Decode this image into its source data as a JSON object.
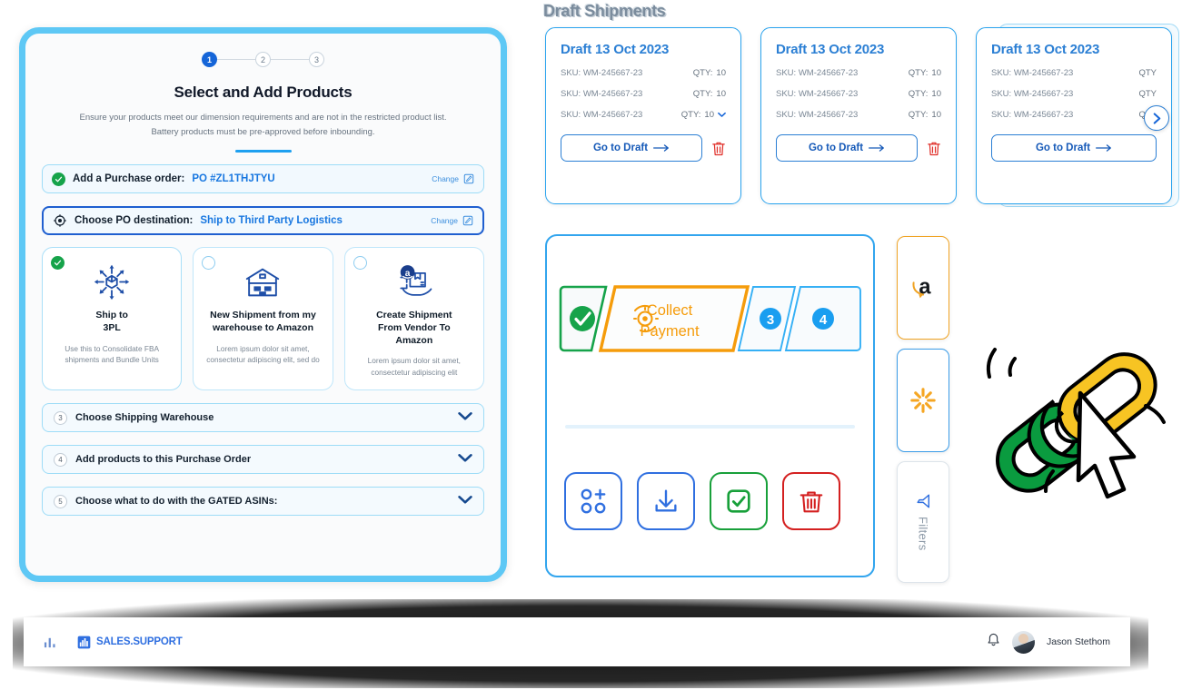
{
  "wizard": {
    "steps": [
      {
        "label": "1",
        "state": "active"
      },
      {
        "label": "2",
        "state": "idle"
      },
      {
        "label": "3",
        "state": "idle"
      }
    ],
    "title": "Select and Add Products",
    "subtitle_line1": "Ensure your products meet our dimension requirements and are not in the restricted product list.",
    "subtitle_line2": "Battery products must be pre-approved before inbounding.",
    "purchase_order": {
      "label": "Add a Purchase order:",
      "value": "PO #ZL1THJTYU",
      "change_label": "Change"
    },
    "destination": {
      "label": "Choose PO destination:",
      "value": "Ship to Third Party Logistics",
      "change_label": "Change"
    },
    "destination_options": [
      {
        "title": "Ship to\n3PL",
        "title_line1": "Ship to",
        "title_line2": "3PL",
        "desc": "Use this to Consolidate FBA shipments and Bundle Units",
        "selected": true,
        "icon": "distribution-network-icon"
      },
      {
        "title_line1": "New Shipment from my",
        "title_line2": "warehouse to Amazon",
        "desc": "Lorem ipsum dolor sit amet, consectetur adipiscing elit, sed do",
        "selected": false,
        "icon": "warehouse-icon"
      },
      {
        "title_line1": "Create Shipment",
        "title_line2": "From Vendor To",
        "title_line3": "Amazon",
        "desc": "Lorem ipsum dolor sit amet, consectetur adipiscing elit",
        "selected": false,
        "icon": "amazon-parcel-handoff-icon"
      }
    ],
    "accordions": [
      {
        "num": "3",
        "label": "Choose Shipping Warehouse"
      },
      {
        "num": "4",
        "label": "Add products to this Purchase Order"
      },
      {
        "num": "5",
        "label": "Choose what to do with the GATED ASINs:"
      }
    ]
  },
  "drafts": {
    "section_title": "Draft Shipments",
    "next_arrow_label": "›",
    "cards": [
      {
        "title": "Draft 13 Oct 2023",
        "rows": [
          {
            "sku_label": "SKU:",
            "sku": "WM-245667-23",
            "qty_label": "QTY:",
            "qty": "10",
            "has_dropdown": false
          },
          {
            "sku_label": "SKU:",
            "sku": "WM-245667-23",
            "qty_label": "QTY:",
            "qty": "10",
            "has_dropdown": false
          },
          {
            "sku_label": "SKU:",
            "sku": "WM-245667-23",
            "qty_label": "QTY:",
            "qty": "10",
            "has_dropdown": true
          }
        ],
        "button": "Go to Draft"
      },
      {
        "title": "Draft 13 Oct 2023",
        "rows": [
          {
            "sku_label": "SKU:",
            "sku": "WM-245667-23",
            "qty_label": "QTY:",
            "qty": "10",
            "has_dropdown": false
          },
          {
            "sku_label": "SKU:",
            "sku": "WM-245667-23",
            "qty_label": "QTY:",
            "qty": "10",
            "has_dropdown": false
          },
          {
            "sku_label": "SKU:",
            "sku": "WM-245667-23",
            "qty_label": "QTY:",
            "qty": "10",
            "has_dropdown": false
          }
        ],
        "button": "Go to Draft"
      },
      {
        "title": "Draft 13 Oct 2023",
        "rows": [
          {
            "sku_label": "SKU:",
            "sku": "WM-245667-23",
            "qty_label": "QTY",
            "qty": "",
            "has_dropdown": false
          },
          {
            "sku_label": "SKU:",
            "sku": "WM-245667-23",
            "qty_label": "QTY",
            "qty": "",
            "has_dropdown": false
          },
          {
            "sku_label": "SKU:",
            "sku": "WM-245667-23",
            "qty_label": "QTY",
            "qty": "",
            "has_dropdown": false
          }
        ],
        "button": "Go to Draft"
      }
    ]
  },
  "payment_panel": {
    "flow_steps": [
      {
        "id": "done",
        "label": "",
        "state": "complete",
        "color": "#16a34a"
      },
      {
        "id": "collect",
        "label_line1": "Collect",
        "label_line2": "Payment",
        "state": "current",
        "color": "#f59c0b"
      },
      {
        "id": "3",
        "label": "3",
        "state": "upcoming",
        "color": "#1a9ef0"
      },
      {
        "id": "4",
        "label": "4",
        "state": "upcoming",
        "color": "#1a9ef0"
      }
    ],
    "actions": [
      {
        "name": "add-items-button",
        "icon": "grid-plus-icon",
        "color": "#2f6fe0"
      },
      {
        "name": "download-button",
        "icon": "download-icon",
        "color": "#2f6fe0"
      },
      {
        "name": "approve-button",
        "icon": "checkbox-check-icon",
        "color": "#18a03a"
      },
      {
        "name": "delete-button",
        "icon": "trash-icon",
        "color": "#d42020"
      }
    ]
  },
  "side_tabs": [
    {
      "name": "amazon-tab",
      "icon": "amazon-logo-icon",
      "accent": "#f0a323"
    },
    {
      "name": "walmart-tab",
      "icon": "walmart-spark-icon",
      "accent": "#3a9ce8"
    },
    {
      "name": "filters-tab",
      "icon": "filter-funnel-icon",
      "label": "Filters",
      "accent": "#dde4ea"
    }
  ],
  "illustration": {
    "name": "chain-link-cursor-illustration",
    "colors": {
      "link_left": "#0a9b3f",
      "link_right": "#f7c423",
      "outline": "#000000"
    }
  },
  "bottom_bar": {
    "logo_text": "SALES.SUPPORT",
    "notification_icon": "bell-icon",
    "user_name": "Jason Stethom"
  },
  "colors": {
    "brand_blue": "#2f6fe0",
    "accent_cyan": "#5ec8f5",
    "success_green": "#16a34a",
    "warning_orange": "#f59c0b",
    "danger_red": "#d42020"
  }
}
